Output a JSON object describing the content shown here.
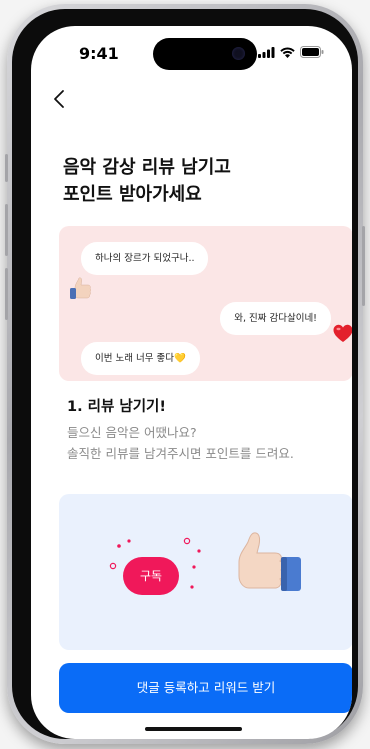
{
  "status": {
    "time": "9:41"
  },
  "header": {
    "title_line1": "음악 감상 리뷰 남기고",
    "title_line2": "포인트 받아가세요"
  },
  "chat": {
    "bubble1": "하나의 장르가 되었구나..",
    "bubble2": "와, 진짜 감다살이네!",
    "bubble3": "이번 노래 너무 좋다💛"
  },
  "step": {
    "title": "1. 리뷰 남기기!",
    "desc_line1": "들으신 음악은 어땠나요?",
    "desc_line2": "솔직한 리뷰를 남겨주시면 포인트를 드려요."
  },
  "illustration": {
    "subscribe_label": "구독"
  },
  "cta": {
    "label": "댓글 등록하고 리워드 받기"
  },
  "colors": {
    "accent": "#0a6cf7",
    "subscribe": "#f0185a",
    "chat_bg": "#fbe6e6",
    "illus_bg": "#eaf1fd"
  },
  "icons": [
    "back-chevron-icon",
    "signal-icon",
    "wifi-icon",
    "battery-icon",
    "thumbs-up-icon",
    "heart-icon"
  ]
}
